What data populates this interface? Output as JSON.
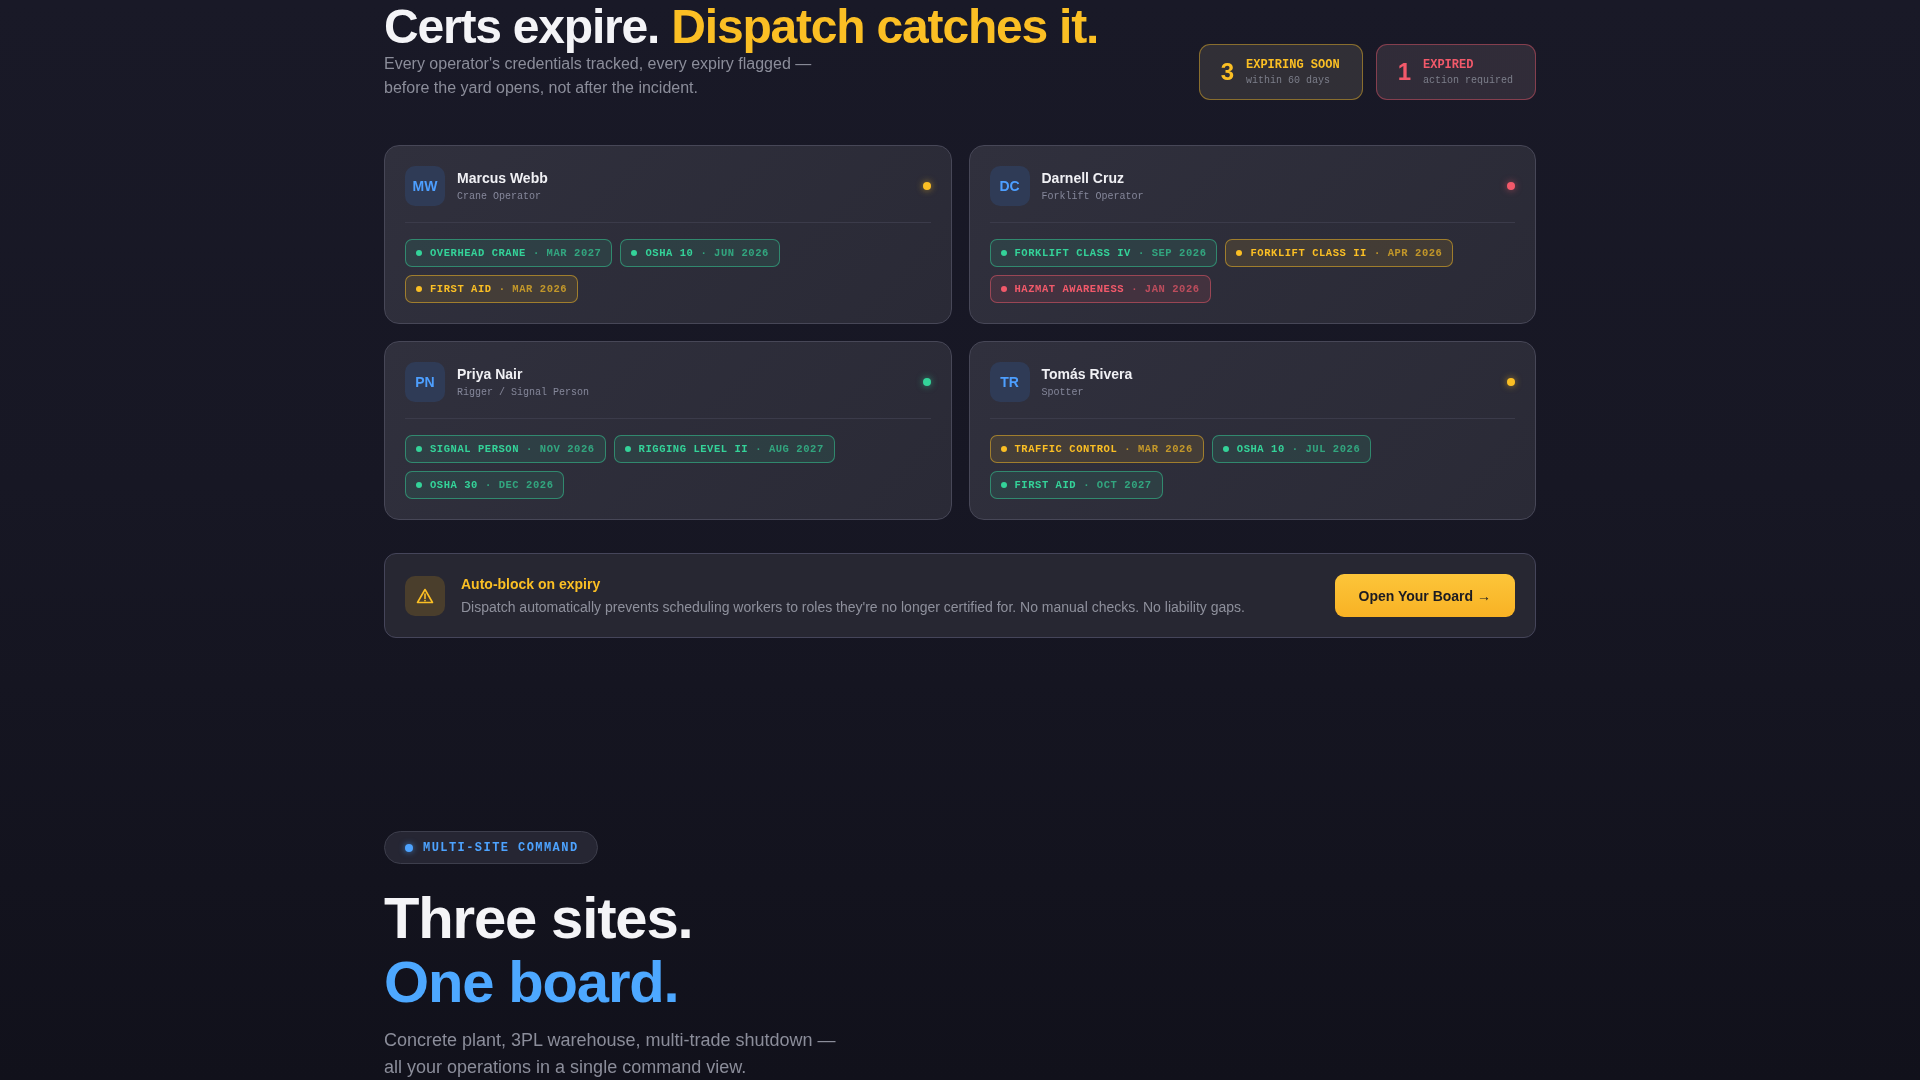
{
  "hero": {
    "title": "Certs expire.",
    "title_accent": "Dispatch catches it.",
    "subtitle": "Every operator's credentials tracked, every expiry flagged — before the yard opens, not after the incident."
  },
  "stats": [
    {
      "count": "3",
      "label": "EXPIRING SOON",
      "detail": "within 60 days",
      "color": "#fbbf24"
    },
    {
      "count": "1",
      "label": "EXPIRED",
      "detail": "action required",
      "color": "#f2596a"
    }
  ],
  "workers": [
    {
      "initials": "MW",
      "name": "Marcus Webb",
      "role": "Crane Operator",
      "color": "#fbbf24",
      "certs": [
        {
          "name": "OVERHEAD CRANE",
          "expiry": "· MAR 2027",
          "color": "#34d399"
        },
        {
          "name": "OSHA 10",
          "expiry": "· JUN 2026",
          "color": "#34d399"
        },
        {
          "name": "FIRST AID",
          "expiry": "· MAR 2026",
          "color": "#fbbf24"
        }
      ]
    },
    {
      "initials": "DC",
      "name": "Darnell Cruz",
      "role": "Forklift Operator",
      "color": "#f2596a",
      "certs": [
        {
          "name": "FORKLIFT CLASS IV",
          "expiry": "· SEP 2026",
          "color": "#34d399"
        },
        {
          "name": "FORKLIFT CLASS II",
          "expiry": "· APR 2026",
          "color": "#fbbf24"
        },
        {
          "name": "HAZMAT AWARENESS",
          "expiry": "· JAN 2026",
          "color": "#f2596a"
        }
      ]
    },
    {
      "initials": "PN",
      "name": "Priya Nair",
      "role": "Rigger / Signal Person",
      "color": "#34d399",
      "certs": [
        {
          "name": "SIGNAL PERSON",
          "expiry": "· NOV 2026",
          "color": "#34d399"
        },
        {
          "name": "RIGGING LEVEL II",
          "expiry": "· AUG 2027",
          "color": "#34d399"
        },
        {
          "name": "OSHA 30",
          "expiry": "· DEC 2026",
          "color": "#34d399"
        }
      ]
    },
    {
      "initials": "TR",
      "name": "Tomás Rivera",
      "role": "Spotter",
      "color": "#fbbf24",
      "certs": [
        {
          "name": "TRAFFIC CONTROL",
          "expiry": "· MAR 2026",
          "color": "#fbbf24"
        },
        {
          "name": "OSHA 10",
          "expiry": "· JUL 2026",
          "color": "#34d399"
        },
        {
          "name": "FIRST AID",
          "expiry": "· OCT 2027",
          "color": "#34d399"
        }
      ]
    }
  ],
  "notice": {
    "title": "Auto-block on expiry",
    "text": "Dispatch automatically prevents scheduling workers to roles they're no longer certified for. No manual checks. No liability gaps.",
    "button": "Open Your Board →"
  },
  "section": {
    "eyebrow": "MULTI-SITE COMMAND",
    "title": "Three sites.",
    "title_accent": "One board.",
    "text": "Concrete plant, 3PL warehouse, multi-trade shutdown — all your operations in a single command view."
  }
}
